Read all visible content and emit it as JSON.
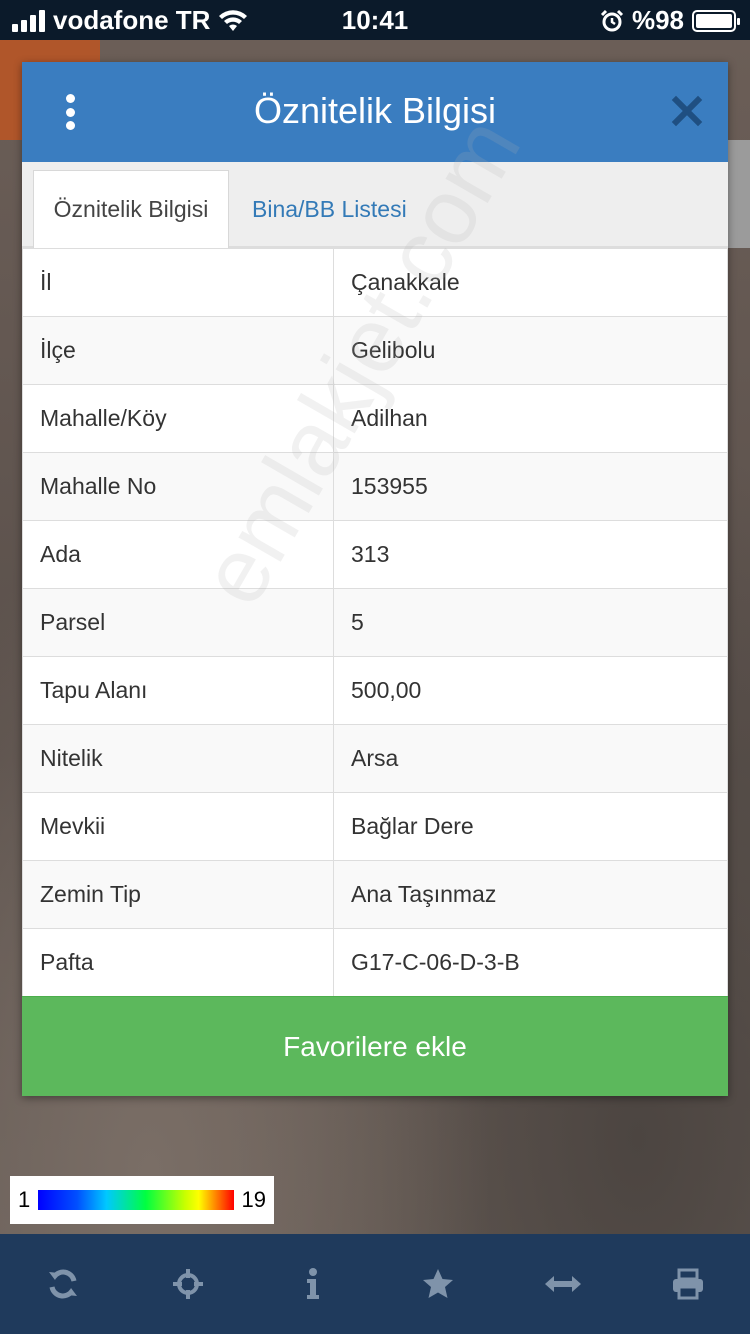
{
  "status_bar": {
    "carrier": "vodafone TR",
    "time": "10:41",
    "battery": "%98"
  },
  "dialog": {
    "title": "Öznitelik Bilgisi",
    "tabs": [
      {
        "label": "Öznitelik Bilgisi",
        "active": true
      },
      {
        "label": "Bina/BB Listesi",
        "active": false
      }
    ],
    "rows": [
      {
        "key": "İl",
        "value": "Çanakkale"
      },
      {
        "key": "İlçe",
        "value": "Gelibolu"
      },
      {
        "key": "Mahalle/Köy",
        "value": "Adilhan"
      },
      {
        "key": "Mahalle No",
        "value": "153955"
      },
      {
        "key": "Ada",
        "value": "313"
      },
      {
        "key": "Parsel",
        "value": "5"
      },
      {
        "key": "Tapu Alanı",
        "value": "500,00"
      },
      {
        "key": "Nitelik",
        "value": "Arsa"
      },
      {
        "key": "Mevkii",
        "value": "Bağlar Dere"
      },
      {
        "key": "Zemin Tip",
        "value": "Ana Taşınmaz"
      },
      {
        "key": "Pafta",
        "value": "G17-C-06-D-3-B"
      }
    ],
    "favorite_button": "Favorilere ekle"
  },
  "watermark": "emlakjet.com",
  "legend": {
    "min": "1",
    "max": "19"
  },
  "toolbar": {
    "items": [
      {
        "icon": "refresh-icon"
      },
      {
        "icon": "crosshairs-icon"
      },
      {
        "icon": "info-icon"
      },
      {
        "icon": "star-icon"
      },
      {
        "icon": "measure-icon"
      },
      {
        "icon": "print-icon"
      }
    ]
  },
  "colors": {
    "header": "#3a7dc0",
    "button": "#5cb85c",
    "toolbar": "#1f3a5c",
    "toolbar_icon": "#7f93aa",
    "tab_link": "#337ab7"
  }
}
